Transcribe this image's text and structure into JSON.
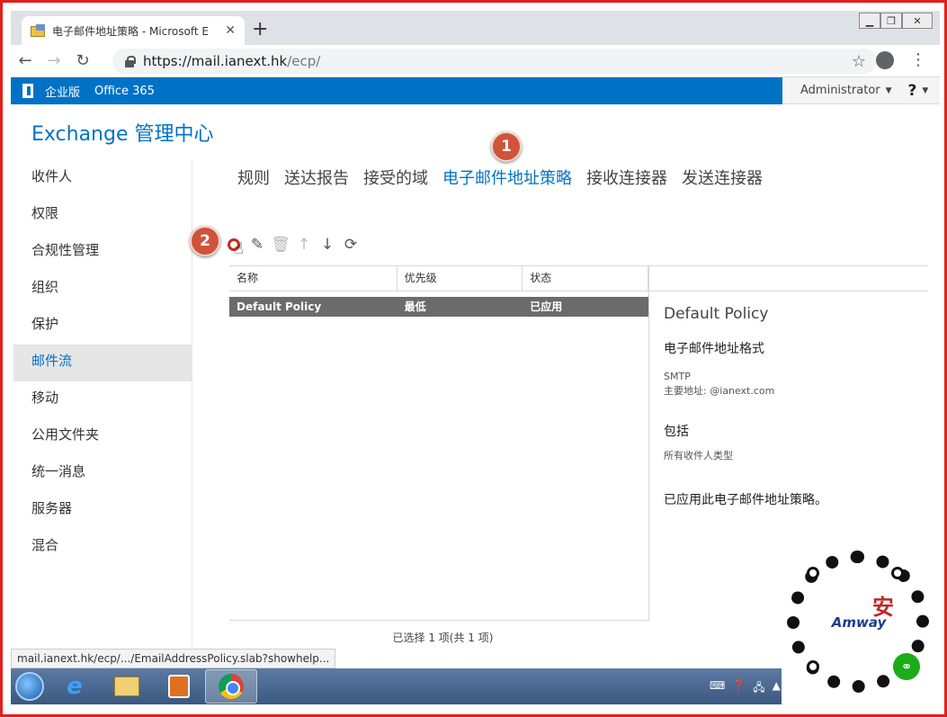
{
  "browser": {
    "tab_title": "电子邮件地址策略 - Microsoft E",
    "tab_close": "✕",
    "new_tab": "+",
    "url_scheme": "https://",
    "url_host": "mail.ianext.hk",
    "url_path": "/ecp/",
    "status_url": "mail.ianext.hk/ecp/.../EmailAddressPolicy.slab?showhelp..."
  },
  "o365": {
    "edition": "企业版",
    "product": "Office 365",
    "user": "Administrator",
    "help": "?"
  },
  "eac": {
    "title_en": "Exchange",
    "title_zh": "管理中心"
  },
  "leftnav": {
    "items": [
      {
        "label": "收件人"
      },
      {
        "label": "权限"
      },
      {
        "label": "合规性管理"
      },
      {
        "label": "组织"
      },
      {
        "label": "保护"
      },
      {
        "label": "邮件流",
        "active": true
      },
      {
        "label": "移动"
      },
      {
        "label": "公用文件夹"
      },
      {
        "label": "统一消息"
      },
      {
        "label": "服务器"
      },
      {
        "label": "混合"
      }
    ]
  },
  "subtabs": {
    "items": [
      {
        "label": "规则"
      },
      {
        "label": "送达报告"
      },
      {
        "label": "接受的域"
      },
      {
        "label": "电子邮件地址策略",
        "active": true
      },
      {
        "label": "接收连接器"
      },
      {
        "label": "发送连接器"
      }
    ]
  },
  "badges": {
    "step1": "1",
    "step2": "2"
  },
  "grid": {
    "columns": [
      "名称",
      "优先级",
      "状态"
    ],
    "rows": [
      {
        "name": "Default Policy",
        "priority": "最低",
        "status": "已应用",
        "selected": true
      }
    ],
    "footer": "已选择 1 项(共 1 项)"
  },
  "detail": {
    "title": "Default Policy",
    "format_heading": "电子邮件地址格式",
    "format_type": "SMTP",
    "format_primary": "主要地址: @ianext.com",
    "include_heading": "包括",
    "include_value": "所有收件人类型",
    "applied_statement": "已应用此电子邮件地址策略。"
  },
  "watermark": {
    "brand": "Amway"
  },
  "colors": {
    "accent": "#0072c6",
    "frame": "#e0201f",
    "selected_row": "#6b6b6b",
    "badge": "#d0533b"
  }
}
